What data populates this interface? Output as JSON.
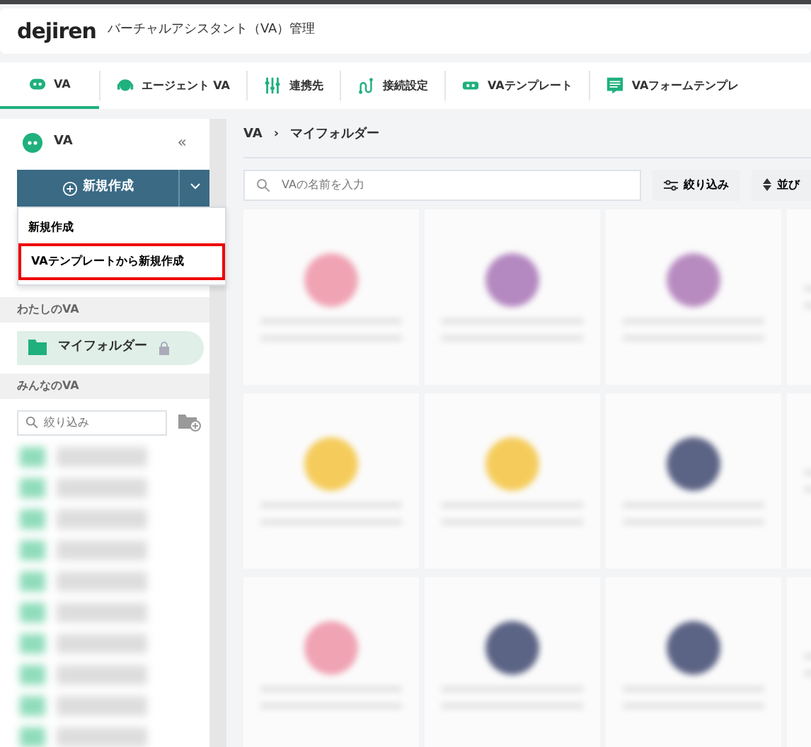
{
  "header": {
    "logo": "dejiren",
    "title": "バーチャルアシスタント（VA）管理"
  },
  "tabs": [
    {
      "label": "VA",
      "selected": true
    },
    {
      "label": "エージェント VA",
      "selected": false
    },
    {
      "label": "連携先",
      "selected": false
    },
    {
      "label": "接続設定",
      "selected": false
    },
    {
      "label": "VAテンプレート",
      "selected": false
    },
    {
      "label": "VAフォームテンプレ",
      "selected": false
    }
  ],
  "sidebar": {
    "title": "VA",
    "collapse_icon": "«",
    "create_button": "新規作成",
    "menu": [
      {
        "label": "新規作成",
        "highlighted": false
      },
      {
        "label": "VAテンプレートから新規作成",
        "highlighted": true
      }
    ],
    "my_section": "わたしのVA",
    "my_folder": {
      "label": "マイフォルダー",
      "locked": true,
      "selected": true
    },
    "shared_section": "みんなのVA",
    "filter_placeholder": "絞り込み",
    "blurred_folders": [
      {
        "kind": "folder"
      },
      {
        "kind": "folder"
      },
      {
        "kind": "folder"
      },
      {
        "kind": "folder"
      },
      {
        "kind": "folder"
      },
      {
        "kind": "folder"
      },
      {
        "kind": "folder"
      },
      {
        "kind": "folder"
      },
      {
        "kind": "folder"
      },
      {
        "kind": "folder"
      }
    ]
  },
  "main": {
    "breadcrumb": [
      "VA",
      "マイフォルダー"
    ],
    "breadcrumb_separator": "›",
    "search_placeholder": "VAの名前を入力",
    "filter_button": "絞り込み",
    "sort_button": "並び",
    "blurred_cards": [
      {
        "kind": "avatar",
        "color": "#f0a3b3"
      },
      {
        "kind": "avatar",
        "color": "#b488c0"
      },
      {
        "kind": "avatar",
        "color": "#b88bc0"
      },
      {
        "kind": "edge"
      },
      {
        "kind": "avatar",
        "color": "#f5cc5c"
      },
      {
        "kind": "avatar",
        "color": "#f5cc5c"
      },
      {
        "kind": "avatar",
        "color": "#5c6485"
      },
      {
        "kind": "edge"
      },
      {
        "kind": "avatar",
        "color": "#f0a3b3"
      },
      {
        "kind": "avatar",
        "color": "#5c6485"
      },
      {
        "kind": "avatar",
        "color": "#5c6485"
      },
      {
        "kind": "edge"
      }
    ]
  }
}
